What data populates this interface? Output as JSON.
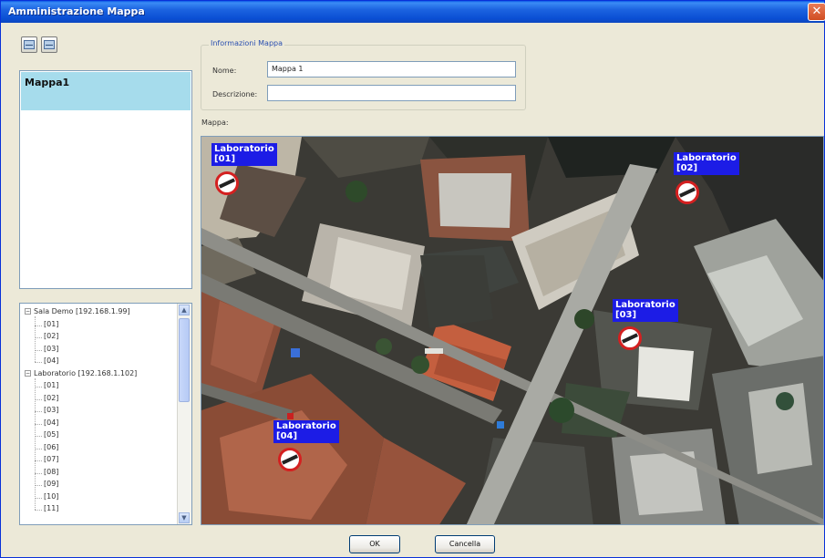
{
  "window": {
    "title": "Amministrazione Mappa",
    "close_glyph": "✕"
  },
  "toolbar": {
    "buttons": [
      {
        "icon": "map-add-icon"
      },
      {
        "icon": "map-remove-icon"
      }
    ]
  },
  "maps_list": {
    "items": [
      {
        "label": "Mappa1"
      }
    ]
  },
  "tree": {
    "nodes": [
      {
        "label": "Sala Demo [192.168.1.99]",
        "level": 0,
        "expander": "−"
      },
      {
        "label": "[01]",
        "level": 1
      },
      {
        "label": "[02]",
        "level": 1
      },
      {
        "label": "[03]",
        "level": 1
      },
      {
        "label": "[04]",
        "level": 1
      },
      {
        "label": "Laboratorio [192.168.1.102]",
        "level": 0,
        "expander": "−"
      },
      {
        "label": "[01]",
        "level": 1
      },
      {
        "label": "[02]",
        "level": 1
      },
      {
        "label": "[03]",
        "level": 1
      },
      {
        "label": "[04]",
        "level": 1
      },
      {
        "label": "[05]",
        "level": 1
      },
      {
        "label": "[06]",
        "level": 1
      },
      {
        "label": "[07]",
        "level": 1
      },
      {
        "label": "[08]",
        "level": 1
      },
      {
        "label": "[09]",
        "level": 1
      },
      {
        "label": "[10]",
        "level": 1
      },
      {
        "label": "[11]",
        "level": 1
      }
    ],
    "scroll_up": "▲",
    "scroll_down": "▼"
  },
  "info": {
    "legend": "Informazioni Mappa",
    "name_label": "Nome:",
    "name_value": "Mappa 1",
    "description_label": "Descrizione:",
    "description_value": ""
  },
  "map": {
    "label": "Mappa:",
    "markers": [
      {
        "text": "Laboratorio\n[01]"
      },
      {
        "text": "Laboratorio\n[02]"
      },
      {
        "text": "Laboratorio\n[03]"
      },
      {
        "text": "Laboratorio\n[04]"
      }
    ]
  },
  "buttons": {
    "ok": "OK",
    "cancel": "Cancella"
  },
  "colors": {
    "title_bar": "#0a4fd4",
    "selection": "#a6dcec",
    "marker_label": "#1c1ce6",
    "marker_ring": "#d42020"
  }
}
